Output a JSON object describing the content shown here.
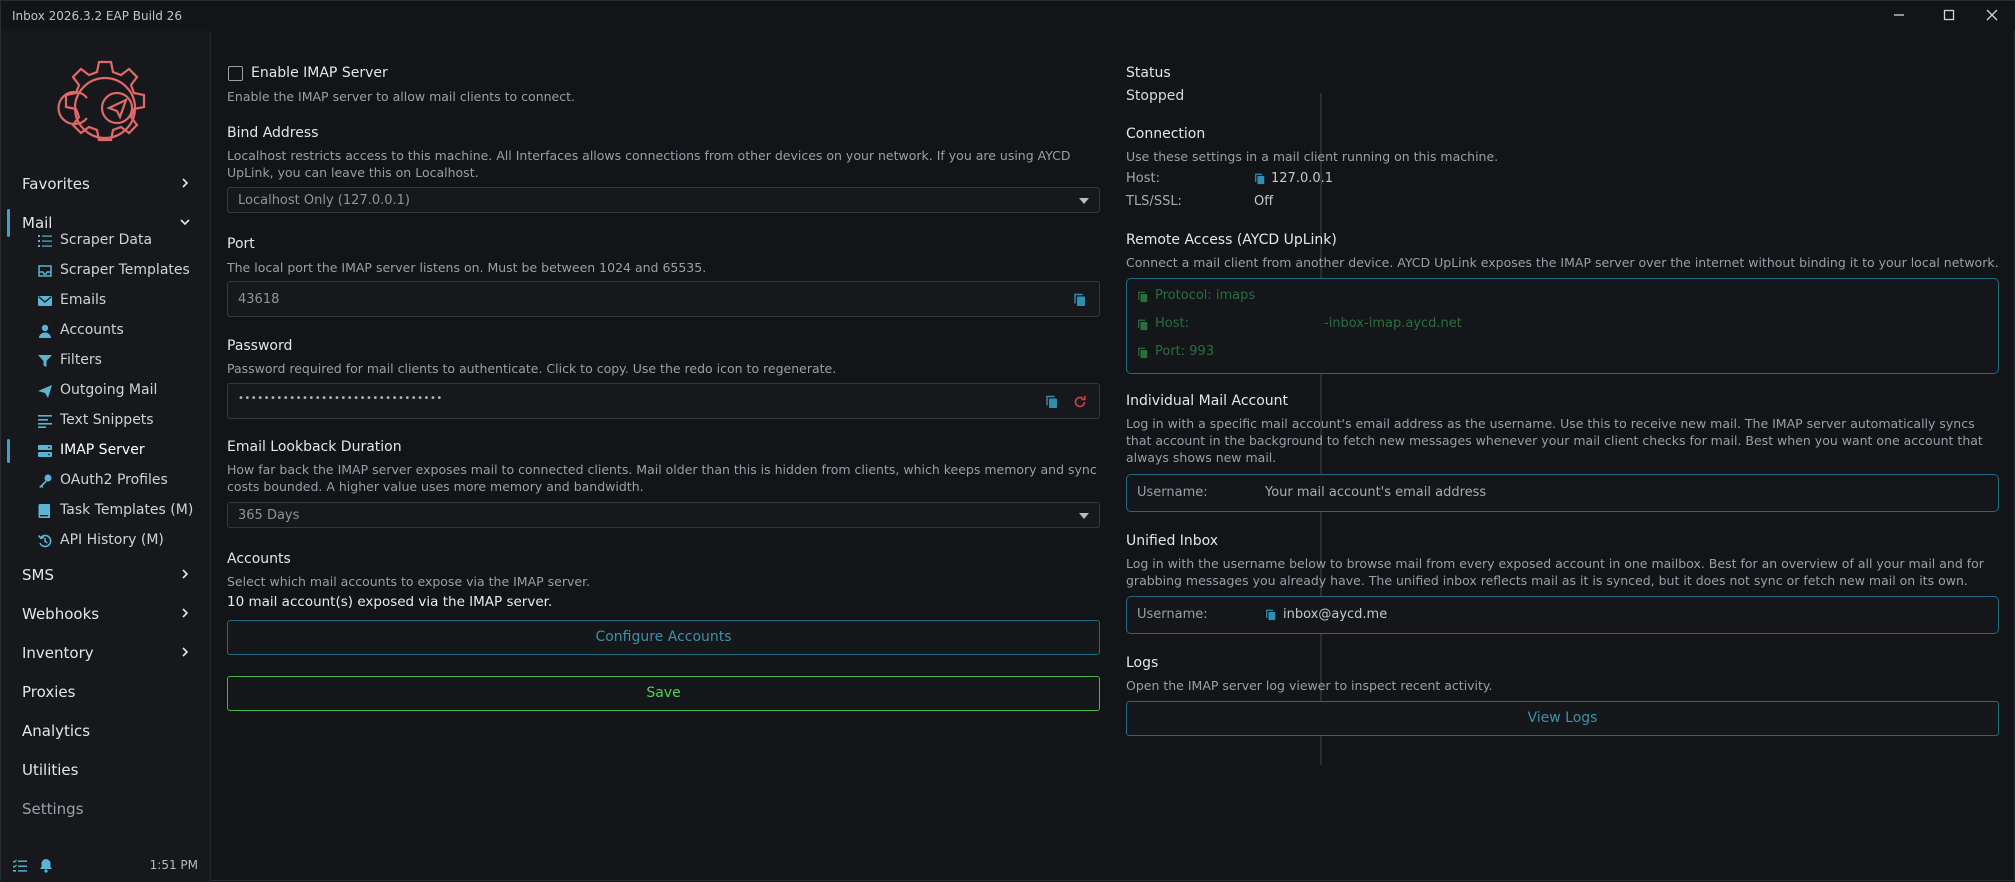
{
  "window": {
    "title": "Inbox 2026.3.2 EAP Build 26"
  },
  "sidebar": {
    "favorites": "Favorites",
    "mail": "Mail",
    "mail_items": [
      {
        "label": "Scraper Data",
        "icon": "list-icon"
      },
      {
        "label": "Scraper Templates",
        "icon": "inbox-tray-icon"
      },
      {
        "label": "Emails",
        "icon": "envelope-icon"
      },
      {
        "label": "Accounts",
        "icon": "person-icon"
      },
      {
        "label": "Filters",
        "icon": "funnel-icon"
      },
      {
        "label": "Outgoing Mail",
        "icon": "paper-plane-icon"
      },
      {
        "label": "Text Snippets",
        "icon": "text-lines-icon"
      },
      {
        "label": "IMAP Server",
        "icon": "server-icon"
      },
      {
        "label": "OAuth2 Profiles",
        "icon": "key-icon"
      },
      {
        "label": "Task Templates (M)",
        "icon": "book-icon"
      },
      {
        "label": "API History (M)",
        "icon": "history-icon"
      }
    ],
    "sms": "SMS",
    "webhooks": "Webhooks",
    "inventory": "Inventory",
    "proxies": "Proxies",
    "analytics": "Analytics",
    "utilities": "Utilities",
    "settings": "Settings",
    "time": "1:51 PM"
  },
  "left": {
    "enable_label": "Enable IMAP Server",
    "enable_checked": false,
    "enable_desc": "Enable the IMAP server to allow mail clients to connect.",
    "bind_title": "Bind Address",
    "bind_desc": "Localhost restricts access to this machine. All Interfaces allows connections from other devices on your network. If you are using AYCD UpLink, you can leave this on Localhost.",
    "bind_value": "Localhost Only (127.0.0.1)",
    "port_title": "Port",
    "port_desc": "The local port the IMAP server listens on. Must be between 1024 and 65535.",
    "port_value": "43618",
    "password_title": "Password",
    "password_desc": "Password required for mail clients to authenticate. Click to copy. Use the redo icon to regenerate.",
    "password_value": "••••••••••••••••••••••••••••••••",
    "lookback_title": "Email Lookback Duration",
    "lookback_desc": "How far back the IMAP server exposes mail to connected clients. Mail older than this is hidden from clients, which keeps memory and sync costs bounded. A higher value uses more memory and bandwidth.",
    "lookback_value": "365 Days",
    "accounts_title": "Accounts",
    "accounts_desc": "Select which mail accounts to expose via the IMAP server.",
    "accounts_count": "10 mail account(s) exposed via the IMAP server.",
    "configure_label": "Configure Accounts",
    "save_label": "Save"
  },
  "right": {
    "status_title": "Status",
    "status_value": "Stopped",
    "connection_title": "Connection",
    "connection_desc": "Use these settings in a mail client running on this machine.",
    "host_key": "Host:",
    "host_val": "127.0.0.1",
    "tls_key": "TLS/SSL:",
    "tls_val": "Off",
    "remote_title": "Remote Access (AYCD UpLink)",
    "remote_desc": "Connect a mail client from another device. AYCD UpLink exposes the IMAP server over the internet without binding it to your local network.",
    "remote_protocol": "Protocol: imaps",
    "remote_host_key": "Host:",
    "remote_host_val": "-inbox-imap.aycd.net",
    "remote_port": "Port: 993",
    "individual_title": "Individual Mail Account",
    "individual_desc": "Log in with a specific mail account's email address as the username. Use this to receive new mail. The IMAP server automatically syncs that account in the background to fetch new messages whenever your mail client checks for mail. Best when you want one account that always shows new mail.",
    "individual_user_key": "Username:",
    "individual_user_val": "Your mail account's email address",
    "unified_title": "Unified Inbox",
    "unified_desc": "Log in with the username below to browse mail from every exposed account in one mailbox. Best for an overview of all your mail and for grabbing messages you already have. The unified inbox reflects mail as it is synced, but it does not sync or fetch new mail on its own.",
    "unified_user_key": "Username:",
    "unified_user_val": "inbox@aycd.me",
    "logs_title": "Logs",
    "logs_desc": "Open the IMAP server log viewer to inspect recent activity.",
    "logs_button": "View Logs"
  },
  "colors": {
    "accent": "#3aa4c9",
    "save_green": "#4bb54b",
    "cyan_border": "#1f6b82",
    "logo": "#e06868"
  }
}
